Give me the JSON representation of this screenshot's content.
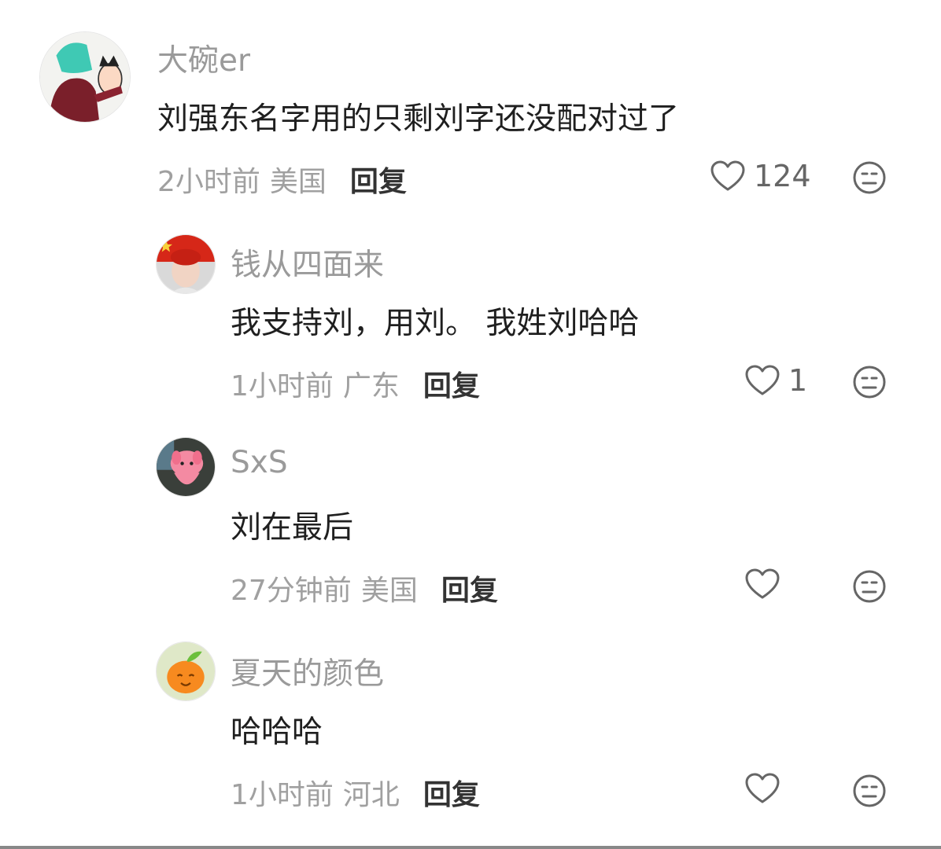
{
  "comments": [
    {
      "username": "大碗er",
      "text": "刘强东名字用的只剩刘字还没配对过了",
      "time": "2小时前",
      "location": "美国",
      "reply_label": "回复",
      "likes": "124",
      "avatar_icon": "cartoon-avatar"
    },
    {
      "username": "钱从四面来",
      "text": "我支持刘，用刘。 我姓刘哈哈",
      "time": "1小时前",
      "location": "广东",
      "reply_label": "回复",
      "likes": "1",
      "avatar_icon": "flag-face-avatar"
    },
    {
      "username": "SxS",
      "text": "刘在最后",
      "time": "27分钟前",
      "location": "美国",
      "reply_label": "回复",
      "likes": "",
      "avatar_icon": "pink-plush-avatar"
    },
    {
      "username": "夏天的颜色",
      "text": "哈哈哈",
      "time": "1小时前",
      "location": "河北",
      "reply_label": "回复",
      "likes": "",
      "avatar_icon": "orange-fruit-avatar"
    }
  ],
  "icons": {
    "like": "heart-icon",
    "dislike": "meh-face-icon"
  },
  "colors": {
    "username": "#9a9a9a",
    "text": "#1f1f1f",
    "meta": "#a0a0a0",
    "reply": "#333333",
    "icon": "#666666"
  }
}
